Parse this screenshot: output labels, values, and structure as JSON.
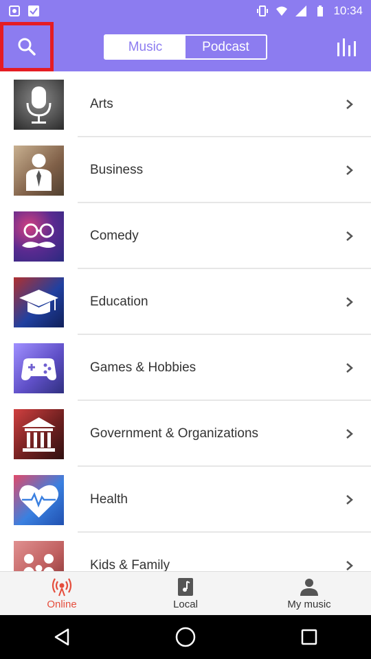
{
  "status_bar": {
    "time": "10:34",
    "icons": [
      "notification-icon",
      "check-icon",
      "vibrate-icon",
      "wifi-icon",
      "signal-icon",
      "battery-icon"
    ]
  },
  "header": {
    "tabs": [
      {
        "label": "Music",
        "active": true
      },
      {
        "label": "Podcast",
        "active": false
      }
    ],
    "search_icon": "search-icon",
    "equalizer_icon": "equalizer-icon",
    "accent_color": "#8c7cf0",
    "highlight_color": "#e51c23"
  },
  "categories": [
    {
      "label": "Arts",
      "icon": "microphone-icon",
      "bg": "#4a4a4a"
    },
    {
      "label": "Business",
      "icon": "businessman-icon",
      "bg": "#a88060"
    },
    {
      "label": "Comedy",
      "icon": "glasses-mustache-icon",
      "bg": "#6a3aa0"
    },
    {
      "label": "Education",
      "icon": "graduation-cap-icon",
      "bg": "#2b4aa8"
    },
    {
      "label": "Games & Hobbies",
      "icon": "gamepad-icon",
      "bg": "#7a68d8"
    },
    {
      "label": "Government & Organizations",
      "icon": "building-icon",
      "bg": "#8a2a2a"
    },
    {
      "label": "Health",
      "icon": "heartbeat-icon",
      "bg": "#3a80e0"
    },
    {
      "label": "Kids & Family",
      "icon": "family-icon",
      "bg": "#d07070"
    }
  ],
  "bottom_nav": [
    {
      "label": "Online",
      "icon": "radio-icon",
      "active": true
    },
    {
      "label": "Local",
      "icon": "music-file-icon",
      "active": false
    },
    {
      "label": "My music",
      "icon": "person-icon",
      "active": false
    }
  ],
  "system_nav": [
    "back-icon",
    "home-icon",
    "recents-icon"
  ]
}
